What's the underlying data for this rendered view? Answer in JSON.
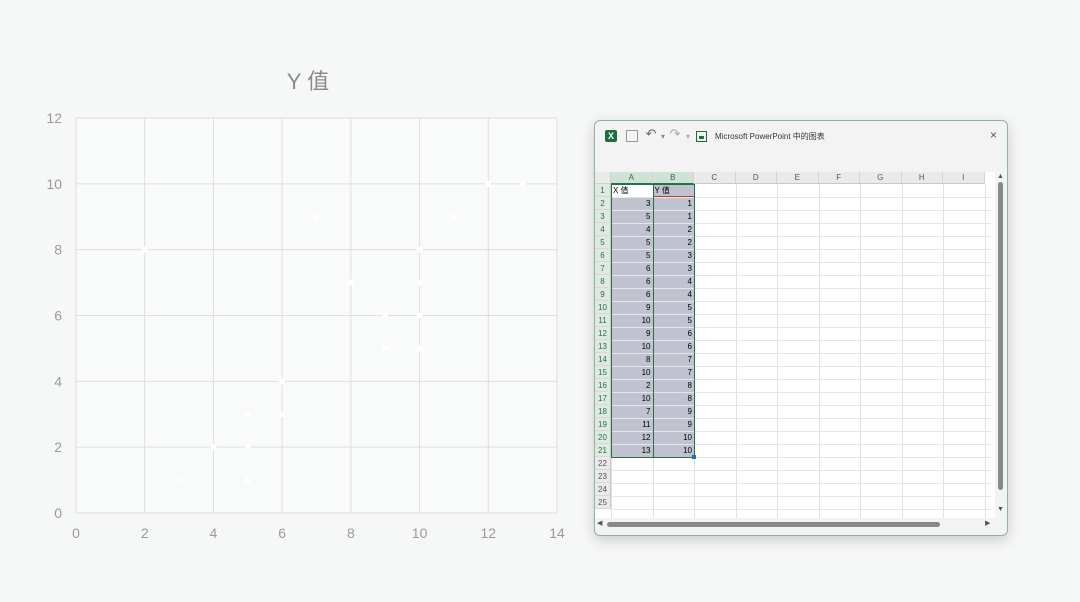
{
  "chart_data": {
    "type": "scatter",
    "title": "Y 值",
    "xlabel": "",
    "ylabel": "",
    "xlim": [
      0,
      14
    ],
    "ylim": [
      0,
      12
    ],
    "xticks": [
      0,
      2,
      4,
      6,
      8,
      10,
      12,
      14
    ],
    "yticks": [
      0,
      2,
      4,
      6,
      8,
      10,
      12
    ],
    "grid": true,
    "point_color": "#ffffff",
    "x": [
      3,
      5,
      4,
      5,
      5,
      6,
      6,
      6,
      9,
      10,
      9,
      10,
      8,
      10,
      2,
      10,
      7,
      11,
      12,
      13
    ],
    "y": [
      1,
      1,
      2,
      2,
      3,
      3,
      4,
      4,
      5,
      5,
      6,
      6,
      7,
      7,
      8,
      8,
      9,
      9,
      10,
      10
    ]
  },
  "excel": {
    "title": "Microsoft PowerPoint 中的图表",
    "close_symbol": "×",
    "columns": [
      "A",
      "B",
      "C",
      "D",
      "E",
      "F",
      "G",
      "H",
      "I"
    ],
    "rows": [
      "1",
      "2",
      "3",
      "4",
      "5",
      "6",
      "7",
      "8",
      "9",
      "10",
      "11",
      "12",
      "13",
      "14",
      "15",
      "16",
      "17",
      "18",
      "19",
      "20",
      "21",
      "22",
      "23",
      "24",
      "25"
    ],
    "header_a": "X 值",
    "header_b": "Y 值",
    "col_a": [
      3,
      5,
      4,
      5,
      5,
      6,
      6,
      6,
      9,
      10,
      9,
      10,
      8,
      10,
      2,
      10,
      7,
      11,
      12,
      13
    ],
    "col_b": [
      1,
      1,
      2,
      2,
      3,
      3,
      4,
      4,
      5,
      5,
      6,
      6,
      7,
      7,
      8,
      8,
      9,
      9,
      10,
      10
    ],
    "accent_color": "#217346",
    "selection_fill": "#c0c2d0"
  }
}
